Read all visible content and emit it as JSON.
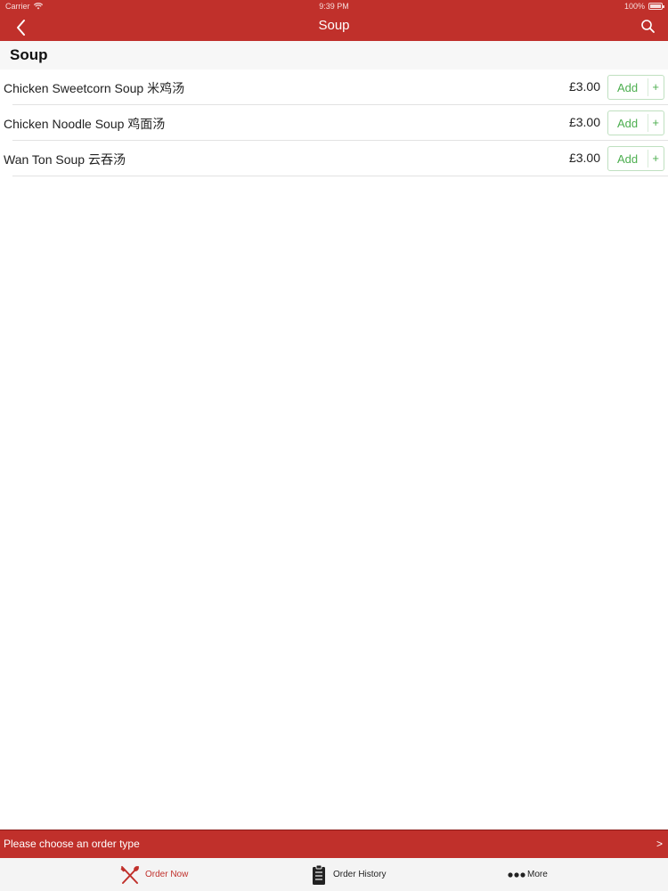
{
  "status_bar": {
    "carrier": "Carrier",
    "time": "9:39 PM",
    "battery": "100%"
  },
  "nav": {
    "title": "Soup",
    "back_icon": "chevron-left-icon",
    "search_icon": "search-icon"
  },
  "section": {
    "title": "Soup"
  },
  "items": [
    {
      "name": "Chicken Sweetcorn Soup  米鸡汤",
      "price": "£3.00",
      "add_label": "Add",
      "plus": "+"
    },
    {
      "name": "Chicken Noodle Soup  鸡面汤",
      "price": "£3.00",
      "add_label": "Add",
      "plus": "+"
    },
    {
      "name": "Wan Ton Soup  云吞汤",
      "price": "£3.00",
      "add_label": "Add",
      "plus": "+"
    }
  ],
  "order_bar": {
    "text": "Please choose an order type",
    "chevron": ">"
  },
  "tabs": [
    {
      "label": "Order Now",
      "icon": "fork-knife-icon",
      "active": true
    },
    {
      "label": "Order History",
      "icon": "clipboard-icon",
      "active": false
    },
    {
      "label": "More",
      "icon": "more-dots-icon",
      "active": false
    }
  ],
  "colors": {
    "brand_red": "#c0302b",
    "add_green": "#4cae4f"
  }
}
